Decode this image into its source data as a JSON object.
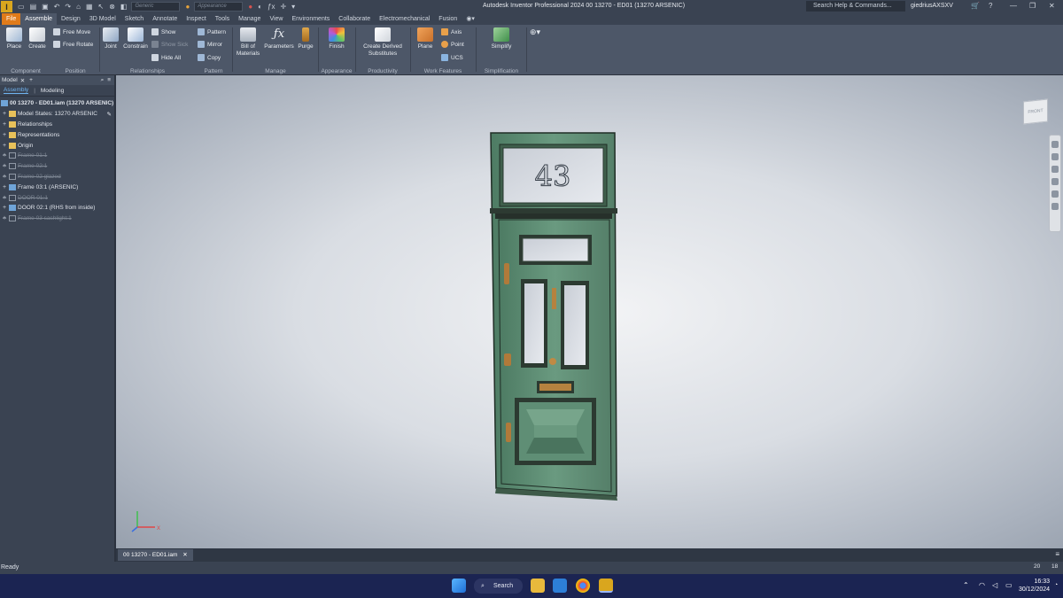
{
  "app": {
    "title": "Autodesk Inventor Professional 2024   00 13270 - ED01 (13270 ARSENIC)",
    "search_placeholder": "Search Help & Commands...",
    "user": "giedriusAXSXV",
    "material_combo": "Generic",
    "appearance_combo": "Appearance"
  },
  "tabs": [
    "File",
    "Assemble",
    "Design",
    "3D Model",
    "Sketch",
    "Annotate",
    "Inspect",
    "Tools",
    "Manage",
    "View",
    "Environments",
    "Collaborate",
    "Electromechanical",
    "Fusion"
  ],
  "active_tab": "Assemble",
  "ribbon": {
    "component": {
      "label": "Component",
      "place": "Place",
      "create": "Create"
    },
    "position": {
      "label": "Position",
      "free_move": "Free Move",
      "free_rotate": "Free Rotate"
    },
    "relationships": {
      "label": "Relationships",
      "joint": "Joint",
      "constrain": "Constrain",
      "show": "Show",
      "show_sick": "Show Sick",
      "hide_all": "Hide All"
    },
    "pattern": {
      "label": "Pattern",
      "pattern": "Pattern",
      "mirror": "Mirror",
      "copy": "Copy"
    },
    "manage": {
      "label": "Manage",
      "bom_line1": "Bill of",
      "bom_line2": "Materials",
      "parameters": "Parameters",
      "purge": "Purge"
    },
    "appearance": {
      "label": "Appearance",
      "finish": "Finish"
    },
    "productivity": {
      "label": "Productivity",
      "derived_line1": "Create Derived",
      "derived_line2": "Substitutes"
    },
    "work_features": {
      "label": "Work Features",
      "plane": "Plane",
      "axis": "Axis",
      "point": "Point",
      "ucs": "UCS"
    },
    "simplification": {
      "label": "Simplification",
      "simplify": "Simplify"
    }
  },
  "browser": {
    "header": "Model",
    "tabs": [
      "Assembly",
      "Modeling"
    ],
    "root": "00 13270 - ED01.iam (13270 ARSENIC)",
    "items": [
      {
        "label": "Model States: 13270 ARSENIC",
        "icon": "model-states",
        "dim": false
      },
      {
        "label": "Relationships",
        "icon": "folder",
        "dim": false
      },
      {
        "label": "Representations",
        "icon": "folder",
        "dim": false
      },
      {
        "label": "Origin",
        "icon": "folder",
        "dim": false
      },
      {
        "label": "Frame 01:1",
        "icon": "part",
        "dim": true
      },
      {
        "label": "Frame 02:1",
        "icon": "part",
        "dim": true
      },
      {
        "label": "Frame 02 glazed",
        "icon": "part",
        "dim": true
      },
      {
        "label": "Frame 03:1 (ARSENIC)",
        "icon": "assembly",
        "dim": false
      },
      {
        "label": "DOOR 01:1",
        "icon": "part",
        "dim": true
      },
      {
        "label": "DOOR 02:1 (RHS from inside)",
        "icon": "assembly",
        "dim": false
      },
      {
        "label": "Frame 03 sashlight:1",
        "icon": "part",
        "dim": true
      }
    ]
  },
  "viewport": {
    "viewcube_label": "FRONT",
    "door_number": "43",
    "triad_x": "X",
    "door_color": "#5c8a72",
    "door_dark": "#2f4a3b"
  },
  "document_tab": "00 13270 - ED01.iam",
  "status": {
    "text": "Ready",
    "count1": "20",
    "count2": "18"
  },
  "taskbar": {
    "search": "Search",
    "time": "16:33",
    "date": "30/12/2024"
  }
}
